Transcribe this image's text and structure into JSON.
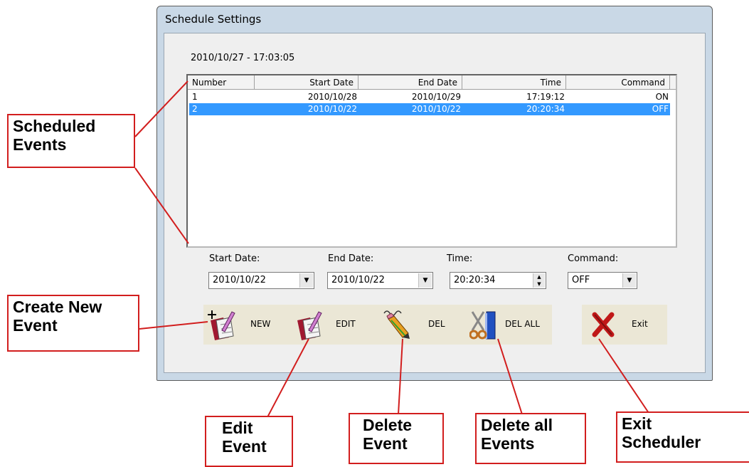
{
  "window": {
    "title": "Schedule Settings",
    "datetime": "2010/10/27 - 17:03:05"
  },
  "table": {
    "columns": [
      "Number",
      "Start Date",
      "End Date",
      "Time",
      "Command"
    ],
    "rows": [
      {
        "number": "1",
        "start": "2010/10/28",
        "end": "2010/10/29",
        "time": "17:19:12",
        "command": "ON",
        "selected": false
      },
      {
        "number": "2",
        "start": "2010/10/22",
        "end": "2010/10/22",
        "time": "20:20:34",
        "command": "OFF",
        "selected": true
      }
    ]
  },
  "fields": {
    "start_date": {
      "label": "Start Date:",
      "value": "2010/10/22"
    },
    "end_date": {
      "label": "End Date:",
      "value": "2010/10/22"
    },
    "time": {
      "label": "Time:",
      "value": "20:20:34"
    },
    "command": {
      "label": "Command:",
      "value": "OFF"
    }
  },
  "buttons": {
    "new": {
      "label": "NEW",
      "icon": "notebook-pen-plus-icon"
    },
    "edit": {
      "label": "EDIT",
      "icon": "notebook-pen-icon"
    },
    "del": {
      "label": "DEL",
      "icon": "pencil-eraser-icon"
    },
    "del_all": {
      "label": "DEL ALL",
      "icon": "scissors-book-icon"
    },
    "exit": {
      "label": "Exit",
      "icon": "red-x-icon"
    }
  },
  "callouts": {
    "scheduled_events": [
      "Scheduled",
      "Events"
    ],
    "create_new_event": [
      "Create New",
      "Event"
    ],
    "edit_event": [
      "Edit",
      "Event"
    ],
    "delete_event": [
      "Delete",
      "Event"
    ],
    "delete_all_events": [
      "Delete all",
      "Events"
    ],
    "exit_scheduler": [
      "Exit",
      "Scheduler"
    ]
  },
  "colors": {
    "callout_border": "#d21e1e",
    "selection": "#3399ff",
    "button_bg": "#ebe7d6"
  }
}
